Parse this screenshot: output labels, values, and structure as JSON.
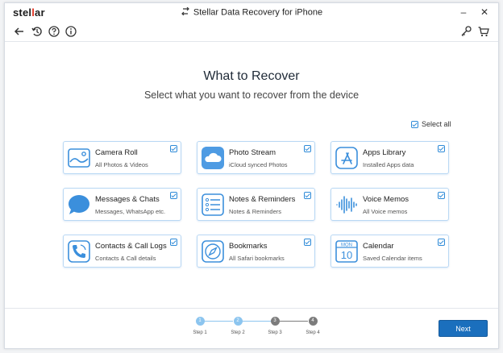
{
  "titlebar": {
    "logo_text_a": "stel",
    "logo_text_mark": "l",
    "logo_text_b": "ar",
    "app_title": "Stellar Data Recovery for iPhone",
    "minimize": "–",
    "close": "✕"
  },
  "main": {
    "heading": "What to Recover",
    "subheading": "Select what you want to recover from the device",
    "select_all": "Select all"
  },
  "cards": [
    {
      "title": "Camera Roll",
      "sub": "All Photos & Videos",
      "icon": "camera-roll-icon"
    },
    {
      "title": "Photo Stream",
      "sub": "iCloud synced Photos",
      "icon": "cloud-icon"
    },
    {
      "title": "Apps Library",
      "sub": "Installed Apps data",
      "icon": "app-store-icon"
    },
    {
      "title": "Messages & Chats",
      "sub": "Messages, WhatsApp etc.",
      "icon": "chat-bubble-icon"
    },
    {
      "title": "Notes & Reminders",
      "sub": "Notes & Reminders",
      "icon": "notes-list-icon"
    },
    {
      "title": "Voice Memos",
      "sub": "All Voice memos",
      "icon": "voice-wave-icon"
    },
    {
      "title": "Contacts & Call Logs",
      "sub": "Contacts & Call details",
      "icon": "phone-icon"
    },
    {
      "title": "Bookmarks",
      "sub": "All Safari bookmarks",
      "icon": "compass-icon"
    },
    {
      "title": "Calendar",
      "sub": "Saved Calendar items",
      "icon": "calendar-icon"
    }
  ],
  "calendar_icon": {
    "month": "MON",
    "day": "10"
  },
  "steps": [
    {
      "num": "1",
      "label": "Step 1",
      "state": "active"
    },
    {
      "num": "2",
      "label": "Step 2",
      "state": "active"
    },
    {
      "num": "3",
      "label": "Step 3",
      "state": "inactive"
    },
    {
      "num": "4",
      "label": "Step 4",
      "state": "inactive"
    }
  ],
  "footer": {
    "next_label": "Next"
  },
  "colors": {
    "accent": "#1b6fbd",
    "card_border": "#b9d8f4",
    "icon_blue": "#3b8fdc",
    "step_active": "#8cc5ef",
    "step_inactive": "#7c7c7c"
  }
}
